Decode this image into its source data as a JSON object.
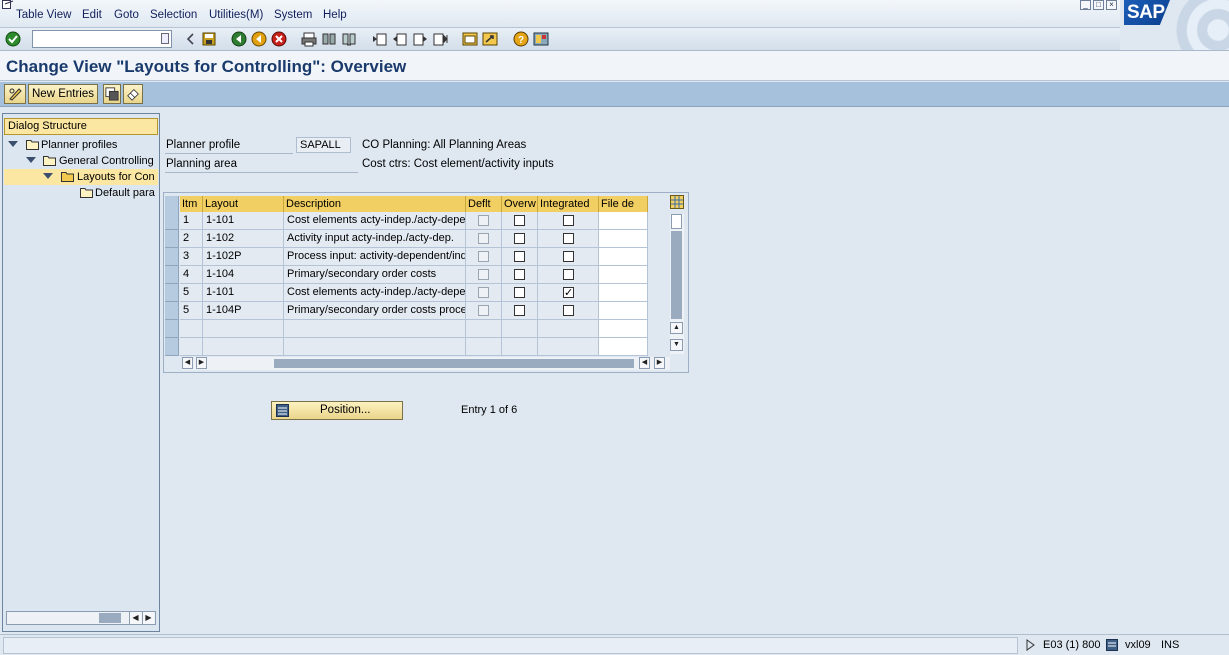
{
  "menu": {
    "items": [
      "Table View",
      "Edit",
      "Goto",
      "Selection",
      "Utilities(M)",
      "System",
      "Help"
    ]
  },
  "toolbar": {
    "command_field_value": "",
    "icons": [
      "enter-icon",
      "command-dropdown-icon",
      "back-arrow-icon",
      "save-icon",
      "back-icon",
      "exit-icon",
      "cancel-icon",
      "print-icon",
      "find-icon",
      "find-next-icon",
      "first-page-icon",
      "previous-page-icon",
      "next-page-icon",
      "last-page-icon",
      "create-session-icon",
      "shortcut-icon",
      "help-icon",
      "layout-icon"
    ]
  },
  "title": "Change View \"Layouts for Controlling\": Overview",
  "app_toolbar": {
    "new_entries_label": "New Entries"
  },
  "nav": {
    "header": "Dialog Structure",
    "items": [
      {
        "label": "Planner profiles"
      },
      {
        "label": "General Controlling"
      },
      {
        "label": "Layouts for Con"
      },
      {
        "label": "Default para"
      }
    ]
  },
  "form": {
    "planner_profile_label": "Planner profile",
    "planner_profile_value": "SAPALL",
    "planner_profile_desc": "CO Planning: All Planning Areas",
    "planning_area_label": "Planning area",
    "planning_area_desc": "Cost ctrs: Cost element/activity inputs"
  },
  "table": {
    "columns": [
      "Itm",
      "Layout",
      "Description",
      "Deflt",
      "Overw",
      "Integrated",
      "File de"
    ],
    "rows": [
      {
        "itm": "1",
        "layout": "1-101",
        "desc": "Cost elements acty-indep./acty-depe",
        "deflt": false,
        "overw": false,
        "integrated": false
      },
      {
        "itm": "2",
        "layout": "1-102",
        "desc": "Activity input acty-indep./acty-dep.",
        "deflt": false,
        "overw": false,
        "integrated": false
      },
      {
        "itm": "3",
        "layout": "1-102P",
        "desc": "Process input: activity-dependent/ind",
        "deflt": false,
        "overw": false,
        "integrated": false
      },
      {
        "itm": "4",
        "layout": "1-104",
        "desc": "Primary/secondary order costs",
        "deflt": false,
        "overw": false,
        "integrated": false
      },
      {
        "itm": "5",
        "layout": "1-101",
        "desc": "Cost elements acty-indep./acty-depe",
        "deflt": false,
        "overw": false,
        "integrated": true
      },
      {
        "itm": "5",
        "layout": "1-104P",
        "desc": "Primary/secondary order costs proce",
        "deflt": false,
        "overw": false,
        "integrated": false
      }
    ]
  },
  "position_button_label": "Position...",
  "entry_info": "Entry 1 of 6",
  "status": {
    "system": "E03 (1) 800",
    "server": "vxl09",
    "mode": "INS"
  }
}
